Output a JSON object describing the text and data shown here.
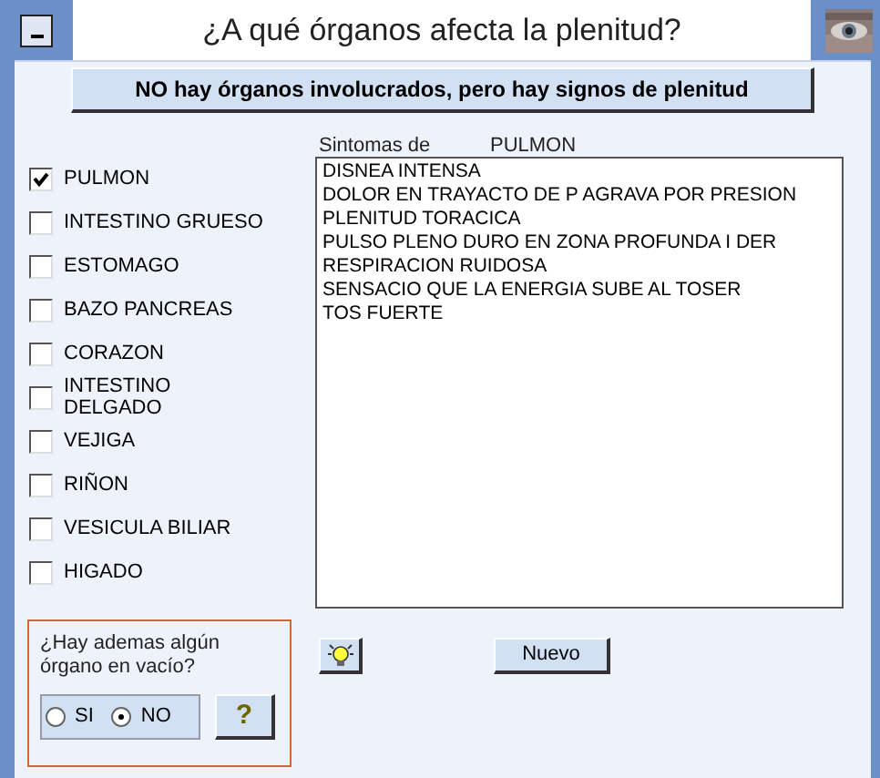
{
  "window": {
    "title": "¿A qué órganos afecta la plenitud?"
  },
  "no_organs_button": "NO hay órganos involucrados, pero hay signos de plenitud",
  "organs": [
    {
      "label": "PULMON",
      "checked": true
    },
    {
      "label": "INTESTINO GRUESO",
      "checked": false
    },
    {
      "label": "ESTOMAGO",
      "checked": false
    },
    {
      "label": "BAZO PANCREAS",
      "checked": false
    },
    {
      "label": "CORAZON",
      "checked": false
    },
    {
      "label": "INTESTINO DELGADO",
      "checked": false
    },
    {
      "label": "VEJIGA",
      "checked": false
    },
    {
      "label": "RIÑON",
      "checked": false
    },
    {
      "label": "VESICULA BILIAR",
      "checked": false
    },
    {
      "label": "HIGADO",
      "checked": false
    }
  ],
  "symptoms": {
    "label": "Sintomas de",
    "organ": "PULMON",
    "lines": [
      "DISNEA INTENSA",
      "DOLOR EN TRAYACTO DE P AGRAVA POR PRESION",
      "PLENITUD TORACICA",
      "PULSO PLENO DURO EN ZONA PROFUNDA I DER",
      "RESPIRACION RUIDOSA",
      "SENSACIO QUE LA ENERGIA SUBE AL TOSER",
      "TOS FUERTE"
    ]
  },
  "empty_organ": {
    "question": "¿Hay ademas algún órgano en vacío?",
    "options": [
      {
        "label": "SI",
        "selected": false
      },
      {
        "label": "NO",
        "selected": true
      }
    ],
    "help_button": "?"
  },
  "new_button": "Nuevo"
}
